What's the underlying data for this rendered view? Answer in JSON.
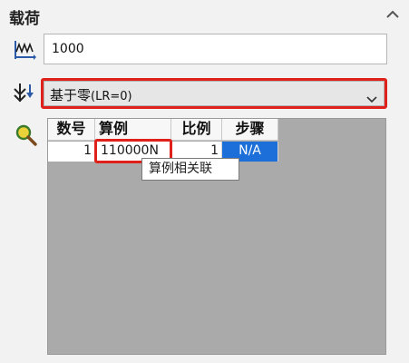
{
  "panel": {
    "title": "载荷"
  },
  "load": {
    "value": "1000"
  },
  "reference": {
    "selected_main": "基于零",
    "selected_suffix": "(LR=0)"
  },
  "table": {
    "columns": [
      "数号",
      "算例",
      "比例",
      "步骤"
    ],
    "rows": [
      {
        "number": "1",
        "case": "110000N",
        "ratio": "1",
        "step": "N/A"
      }
    ]
  },
  "tooltip": {
    "text": "算例相关联"
  },
  "colors": {
    "highlight": "#e0201b",
    "selection": "#1c6fd8",
    "grid_background": "#aaaaaa"
  },
  "icons": {
    "load_row": "force-wave-icon",
    "reference_row": "reference-arrow-icon",
    "table_row": "magnifier-icon",
    "collapse": "chevron-up-icon"
  }
}
